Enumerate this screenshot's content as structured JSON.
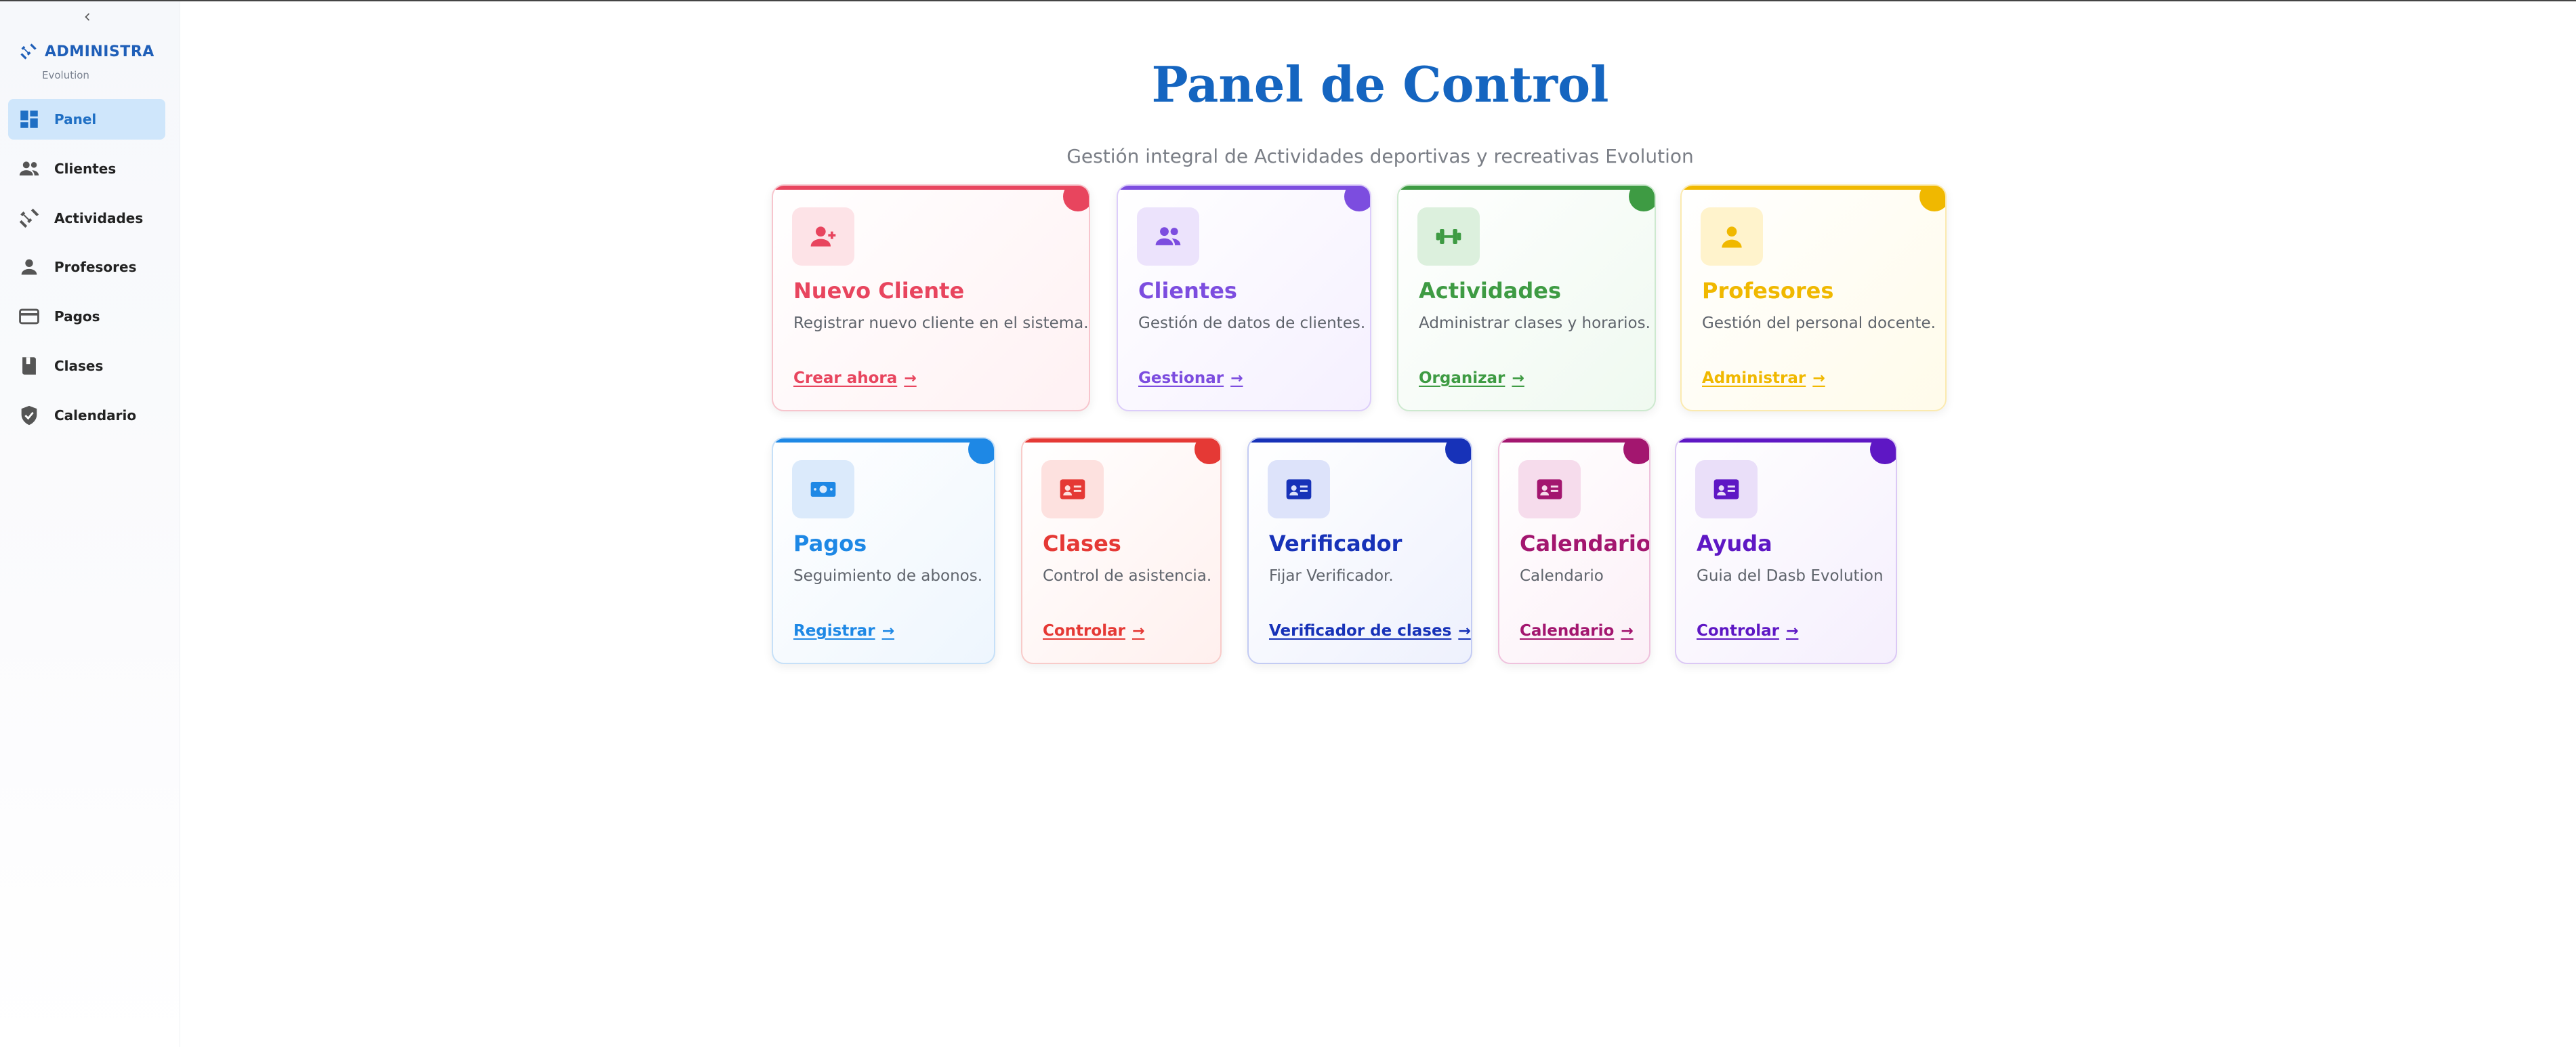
{
  "sidebar": {
    "collapse_icon": "chevron-left-icon",
    "brand_title": "ADMINISTRA",
    "brand_sub": "Evolution",
    "items": [
      {
        "label": "Panel",
        "icon": "dashboard-icon",
        "active": true
      },
      {
        "label": "Clientes",
        "icon": "people-icon",
        "active": false
      },
      {
        "label": "Actividades",
        "icon": "fitness-icon",
        "active": false
      },
      {
        "label": "Profesores",
        "icon": "person-icon",
        "active": false
      },
      {
        "label": "Pagos",
        "icon": "credit-card-icon",
        "active": false
      },
      {
        "label": "Clases",
        "icon": "book-icon",
        "active": false
      },
      {
        "label": "Calendario",
        "icon": "shield-check-icon",
        "active": false
      }
    ]
  },
  "main": {
    "title": "Panel de Control",
    "subtitle": "Gestión integral de Actividades deportivas y recreativas Evolution"
  },
  "cards": [
    {
      "title": "Nuevo Cliente",
      "desc": "Registrar nuevo cliente en el sistema.",
      "link": "Crear ahora",
      "icon": "person-add-icon",
      "color": "#e8455e"
    },
    {
      "title": "Clientes",
      "desc": "Gestión de datos de clientes.",
      "link": "Gestionar",
      "icon": "people-icon",
      "color": "#7c4ddf"
    },
    {
      "title": "Actividades",
      "desc": "Administrar clases y horarios.",
      "link": "Organizar",
      "icon": "fitness-icon",
      "color": "#3e9b43"
    },
    {
      "title": "Profesores",
      "desc": "Gestión del personal docente.",
      "link": "Administrar",
      "icon": "person-icon",
      "color": "#f0b800"
    },
    {
      "title": "Pagos",
      "desc": "Seguimiento de abonos.",
      "link": "Registrar",
      "icon": "money-icon",
      "color": "#1e88e5"
    },
    {
      "title": "Clases",
      "desc": "Control de asistencia.",
      "link": "Controlar",
      "icon": "id-card-icon",
      "color": "#e53935"
    },
    {
      "title": "Verificador",
      "desc": "Fijar Verificador.",
      "link": "Verificador de clases",
      "icon": "id-card-icon",
      "color": "#1732b8"
    },
    {
      "title": "Calendario",
      "desc": "Calendario",
      "link": "Calendario",
      "icon": "id-card-icon",
      "color": "#a3166f"
    },
    {
      "title": "Ayuda",
      "desc": "Guia del Dasb Evolution",
      "link": "Controlar",
      "icon": "id-card-icon",
      "color": "#5e17c4"
    }
  ]
}
